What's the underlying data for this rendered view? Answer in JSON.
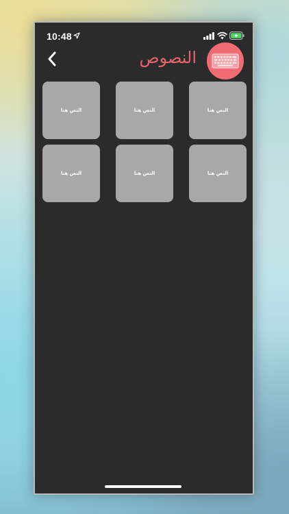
{
  "status_bar": {
    "time": "10:48",
    "icons": [
      "location-arrow-icon",
      "cellular-signal-icon",
      "wifi-icon",
      "battery-charging-icon"
    ]
  },
  "header": {
    "title": "النصوص",
    "back_icon": "chevron-left-icon",
    "badge_icon": "keyboard-icon"
  },
  "colors": {
    "background": "#2b2b2b",
    "accent": "#f06b73",
    "tile": "#a8a8a8",
    "battery": "#4cd964"
  },
  "grid": {
    "tiles": [
      {
        "label": "النص هنا"
      },
      {
        "label": "النص هنا"
      },
      {
        "label": "النص هنا"
      },
      {
        "label": "النص هنا"
      },
      {
        "label": "النص هنا"
      },
      {
        "label": "النص هنا"
      }
    ]
  }
}
